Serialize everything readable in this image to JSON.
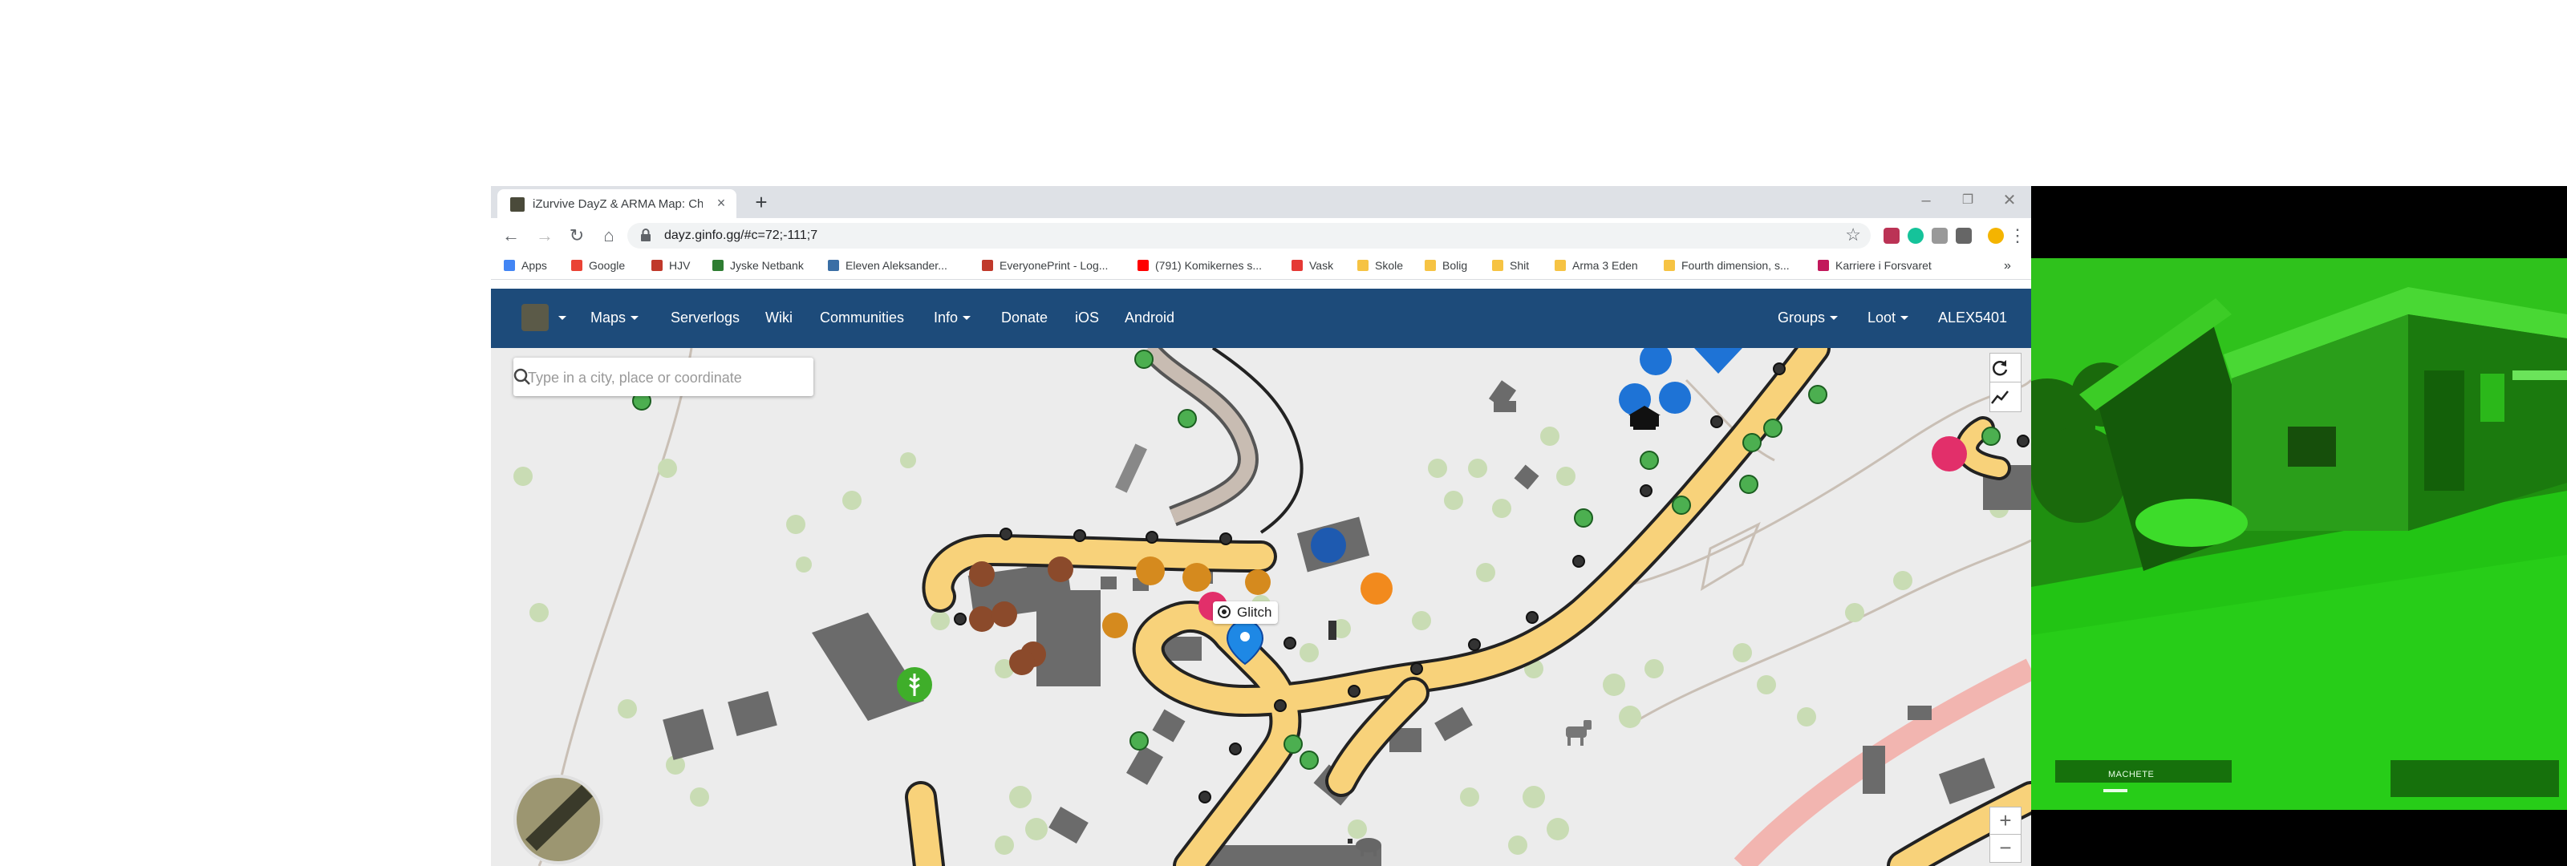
{
  "browser": {
    "tab": {
      "title": "iZurvive DayZ & ARMA Map: Che"
    },
    "url": "dayz.ginfo.gg/#c=72;-111;7",
    "bookmarks": [
      {
        "label": "Apps",
        "color": "#4285f4"
      },
      {
        "label": "Google",
        "color": "#ea4335"
      },
      {
        "label": "HJV",
        "color": "#c0392b"
      },
      {
        "label": "Jyske Netbank",
        "color": "#2e7d32"
      },
      {
        "label": "Eleven Aleksander...",
        "color": "#3a6ea5"
      },
      {
        "label": "EveryonePrint - Log...",
        "color": "#c0392b"
      },
      {
        "label": "(791) Komikernes s...",
        "color": "#ff0000"
      },
      {
        "label": "Vask",
        "color": "#e53935"
      },
      {
        "label": "Skole",
        "color": "#f6c343"
      },
      {
        "label": "Bolig",
        "color": "#f6c343"
      },
      {
        "label": "Shit",
        "color": "#f6c343"
      },
      {
        "label": "Arma 3 Eden",
        "color": "#f6c343"
      },
      {
        "label": "Fourth dimension, s...",
        "color": "#f6c343"
      },
      {
        "label": "Karriere i Forsvaret",
        "color": "#c2185b"
      }
    ],
    "bookmarks_more": "»"
  },
  "site": {
    "nav_left": [
      "Maps",
      "Serverlogs",
      "Wiki",
      "Communities",
      "Info",
      "Donate",
      "iOS",
      "Android"
    ],
    "nav_right": [
      "Groups",
      "Loot",
      "ALEX5401"
    ],
    "brand_color": "#1d4b7a"
  },
  "map": {
    "search_placeholder": "Type in a city, place or coordinate",
    "marker_label": "Glitch",
    "zoom_in": "+",
    "zoom_out": "−",
    "road_color": "#f8d27a",
    "icons": [
      "search-icon",
      "refresh-icon",
      "trend-icon",
      "location-pin-icon",
      "cart-icon",
      "car-icon",
      "horse-icon",
      "boar-icon",
      "wheat-icon",
      "carousel-icon",
      "shop-icon"
    ]
  },
  "game": {
    "weapon": "MACHETE",
    "tint": "#22cc11"
  }
}
